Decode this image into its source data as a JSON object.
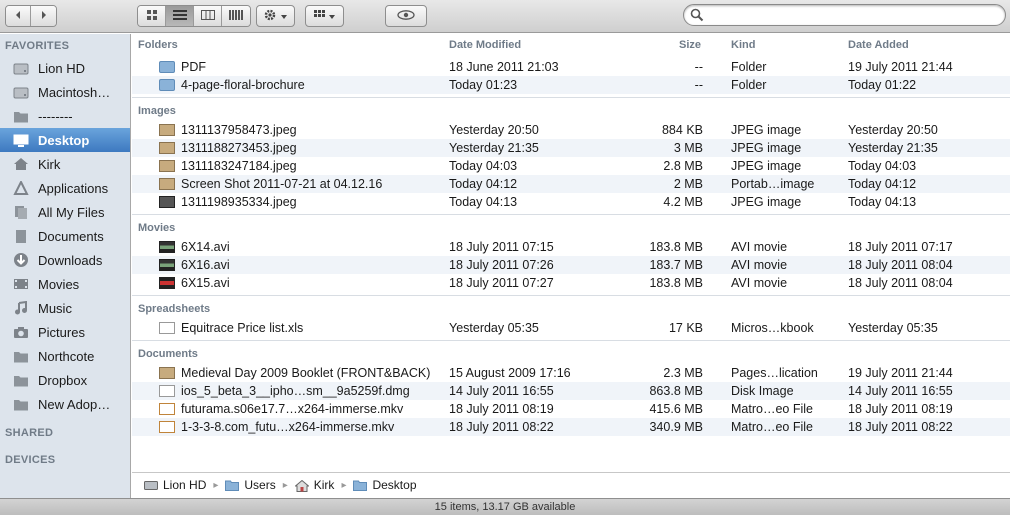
{
  "toolbar": {
    "back_icon": "chevron-left-icon",
    "forward_icon": "chevron-right-icon",
    "view_modes": [
      "icon-view",
      "list-view",
      "column-view",
      "coverflow-view"
    ],
    "active_view": "list-view",
    "action_icon": "gear-icon",
    "arrange_icon": "grid-icon",
    "quicklook_icon": "eye-icon",
    "search_placeholder": ""
  },
  "sidebar": {
    "favorites_label": "FAVORITES",
    "shared_label": "SHARED",
    "devices_label": "DEVICES",
    "items": [
      {
        "label": "Lion HD",
        "icon": "hard-drive-icon"
      },
      {
        "label": "Macintosh…",
        "icon": "hard-drive-icon"
      },
      {
        "label": "--------",
        "icon": "folder-icon"
      },
      {
        "label": "Desktop",
        "icon": "desktop-icon",
        "selected": true
      },
      {
        "label": "Kirk",
        "icon": "home-icon"
      },
      {
        "label": "Applications",
        "icon": "applications-icon"
      },
      {
        "label": "All My Files",
        "icon": "all-files-icon"
      },
      {
        "label": "Documents",
        "icon": "documents-icon"
      },
      {
        "label": "Downloads",
        "icon": "downloads-icon"
      },
      {
        "label": "Movies",
        "icon": "movies-icon"
      },
      {
        "label": "Music",
        "icon": "music-icon"
      },
      {
        "label": "Pictures",
        "icon": "camera-icon"
      },
      {
        "label": "Northcote",
        "icon": "folder-icon"
      },
      {
        "label": "Dropbox",
        "icon": "folder-icon"
      },
      {
        "label": "New Adop…",
        "icon": "folder-icon"
      }
    ]
  },
  "columns": {
    "name": "Folders",
    "modified": "Date Modified",
    "size": "Size",
    "kind": "Kind",
    "added": "Date Added"
  },
  "groups": [
    {
      "label": "Folders",
      "rows": [
        {
          "name": "PDF",
          "modified": "18 June 2011 21:03",
          "size": "--",
          "kind": "Folder",
          "added": "19 July 2011 21:44",
          "icon": "folder-icon"
        },
        {
          "name": "4-page-floral-brochure",
          "modified": "Today 01:23",
          "size": "--",
          "kind": "Folder",
          "added": "Today 01:22",
          "icon": "folder-icon"
        }
      ]
    },
    {
      "label": "Images",
      "rows": [
        {
          "name": "1311137958473.jpeg",
          "modified": "Yesterday 20:50",
          "size": "884 KB",
          "kind": "JPEG image",
          "added": "Yesterday 20:50",
          "icon": "image-icon"
        },
        {
          "name": "1311188273453.jpeg",
          "modified": "Yesterday 21:35",
          "size": "3 MB",
          "kind": "JPEG image",
          "added": "Yesterday 21:35",
          "icon": "image-icon"
        },
        {
          "name": "1311183247184.jpeg",
          "modified": "Today 04:03",
          "size": "2.8 MB",
          "kind": "JPEG image",
          "added": "Today 04:03",
          "icon": "image-icon"
        },
        {
          "name": "Screen Shot 2011-07-21 at 04.12.16",
          "modified": "Today 04:12",
          "size": "2 MB",
          "kind": "Portab…image",
          "added": "Today 04:12",
          "icon": "image-icon"
        },
        {
          "name": "1311198935334.jpeg",
          "modified": "Today 04:13",
          "size": "4.2 MB",
          "kind": "JPEG image",
          "added": "Today 04:13",
          "icon": "image-dark-icon"
        }
      ]
    },
    {
      "label": "Movies",
      "rows": [
        {
          "name": "6X14.avi",
          "modified": "18 July 2011 07:15",
          "size": "183.8 MB",
          "kind": "AVI movie",
          "added": "18 July 2011 07:17",
          "icon": "movie-icon"
        },
        {
          "name": "6X16.avi",
          "modified": "18 July 2011 07:26",
          "size": "183.7 MB",
          "kind": "AVI movie",
          "added": "18 July 2011 08:04",
          "icon": "movie-icon"
        },
        {
          "name": "6X15.avi",
          "modified": "18 July 2011 07:27",
          "size": "183.8 MB",
          "kind": "AVI movie",
          "added": "18 July 2011 08:04",
          "icon": "movie-red-icon"
        }
      ]
    },
    {
      "label": "Spreadsheets",
      "rows": [
        {
          "name": "Equitrace Price list.xls",
          "modified": "Yesterday 05:35",
          "size": "17 KB",
          "kind": "Micros…kbook",
          "added": "Yesterday 05:35",
          "icon": "document-icon"
        }
      ]
    },
    {
      "label": "Documents",
      "rows": [
        {
          "name": "Medieval Day 2009 Booklet (FRONT&BACK)",
          "modified": "15 August 2009 17:16",
          "size": "2.3 MB",
          "kind": "Pages…lication",
          "added": "19 July 2011 21:44",
          "icon": "image-icon"
        },
        {
          "name": "ios_5_beta_3__ipho…sm__9a5259f.dmg",
          "modified": "14 July 2011 16:55",
          "size": "863.8 MB",
          "kind": "Disk Image",
          "added": "14 July 2011 16:55",
          "icon": "document-icon"
        },
        {
          "name": "futurama.s06e17.7…x264-immerse.mkv",
          "modified": "18 July 2011 08:19",
          "size": "415.6 MB",
          "kind": "Matro…eo File",
          "added": "18 July 2011 08:19",
          "icon": "mkv-icon"
        },
        {
          "name": "1-3-3-8.com_futu…x264-immerse.mkv",
          "modified": "18 July 2011 08:22",
          "size": "340.9 MB",
          "kind": "Matro…eo File",
          "added": "18 July 2011 08:22",
          "icon": "mkv-icon"
        }
      ]
    }
  ],
  "pathbar": [
    {
      "label": "Lion HD",
      "icon": "hard-drive-icon"
    },
    {
      "label": "Users",
      "icon": "folder-icon"
    },
    {
      "label": "Kirk",
      "icon": "home-icon"
    },
    {
      "label": "Desktop",
      "icon": "folder-icon"
    }
  ],
  "status": "15 items, 13.17 GB available",
  "colors": {
    "selection": "#3d79c0",
    "sidebar_bg": "#dde4ec",
    "alt_row": "#f0f4f9"
  }
}
